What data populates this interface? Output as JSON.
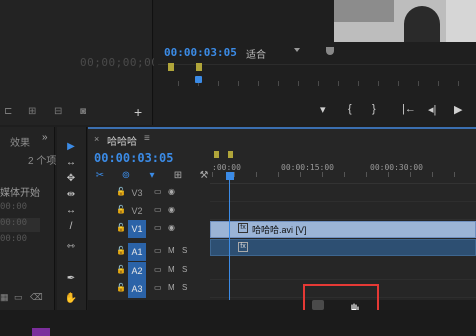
{
  "source_monitor": {
    "timecode": "00;00;00;00",
    "add_label": "+"
  },
  "program_monitor": {
    "timecode": "00:00:03:05",
    "fit_label": "适合",
    "controls": [
      "▾",
      "{",
      "}",
      "|←",
      "◂|",
      "▶"
    ]
  },
  "project_panel": {
    "effects_tab": "效果",
    "more": "»",
    "item_count": "2 个项",
    "media_start": "媒体开始",
    "rows": [
      "00:00",
      "00:00",
      "00:00"
    ]
  },
  "tools": [
    "▶",
    "↔",
    "✥",
    "⇹",
    "↔",
    "/",
    "⇿",
    "✒",
    "✋"
  ],
  "timeline": {
    "close": "×",
    "title": "哈哈哈",
    "menu": "≡",
    "timecode": "00:00:03:05",
    "ruler_labels": [
      ":00:00",
      "00:00:15:00",
      "00:00:30:00"
    ],
    "tracks": [
      {
        "name": "V3",
        "type": "video",
        "active": false
      },
      {
        "name": "V2",
        "type": "video",
        "active": false
      },
      {
        "name": "V1",
        "type": "video",
        "active": true
      },
      {
        "name": "A1",
        "type": "audio",
        "active": true
      },
      {
        "name": "A2",
        "type": "audio",
        "active": true
      },
      {
        "name": "A3",
        "type": "audio",
        "active": true
      }
    ],
    "video_clip_label": "哈哈哈.avi [V]",
    "clip_icon": "fx"
  },
  "colors": {
    "accent": "#3b8be6",
    "highlight": "#e53935",
    "track_active": "#2b63a8",
    "video_clip": "#9bb4d6",
    "audio_clip": "#2d4f72"
  }
}
